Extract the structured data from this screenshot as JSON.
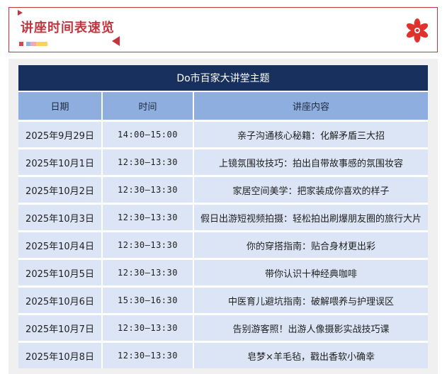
{
  "header": {
    "title": "讲座时间表速览",
    "colors": {
      "accent": "#c2353f",
      "stripe_red": "#d64550",
      "stripe_blue": "#8eb3e8",
      "stripe_pink": "#f2a7bd",
      "stripe_yellow": "#f7d35a"
    },
    "flower_icon": "flower-icon"
  },
  "table": {
    "title": "Do市百家大讲堂主题",
    "columns": [
      "日期",
      "时间",
      "讲座内容"
    ],
    "rows": [
      {
        "date": "2025年9月29日",
        "time": "14:00–15:00",
        "topic": "亲子沟通核心秘籍：化解矛盾三大招"
      },
      {
        "date": "2025年10月1日",
        "time": "12:30–13:30",
        "topic": "上镜氛围妆技巧：拍出自带故事感的氛围妆容"
      },
      {
        "date": "2025年10月2日",
        "time": "12:30–13:30",
        "topic": "家居空间美学：把家装成你喜欢的样子"
      },
      {
        "date": "2025年10月3日",
        "time": "12:30–13:30",
        "topic": "假日出游短视频拍摄：轻松拍出刷爆朋友圈的旅行大片"
      },
      {
        "date": "2025年10月4日",
        "time": "12:30–13:30",
        "topic": "你的穿搭指南：贴合身材更出彩"
      },
      {
        "date": "2025年10月5日",
        "time": "12:30–13:30",
        "topic": "带你认识十种经典咖啡"
      },
      {
        "date": "2025年10月6日",
        "time": "15:30–16:30",
        "topic": "中医育儿避坑指南：破解喂养与护理误区"
      },
      {
        "date": "2025年10月7日",
        "time": "12:30–13:30",
        "topic": "告别游客照！出游人像摄影实战技巧课"
      },
      {
        "date": "2025年10月8日",
        "time": "12:30–13:30",
        "topic": "皂梦×羊毛毡，戳出香软小确幸"
      }
    ],
    "colors": {
      "title_bg": "#17305e",
      "header_bg": "#8eaee0",
      "row_bg": "#dbe5f5"
    }
  }
}
